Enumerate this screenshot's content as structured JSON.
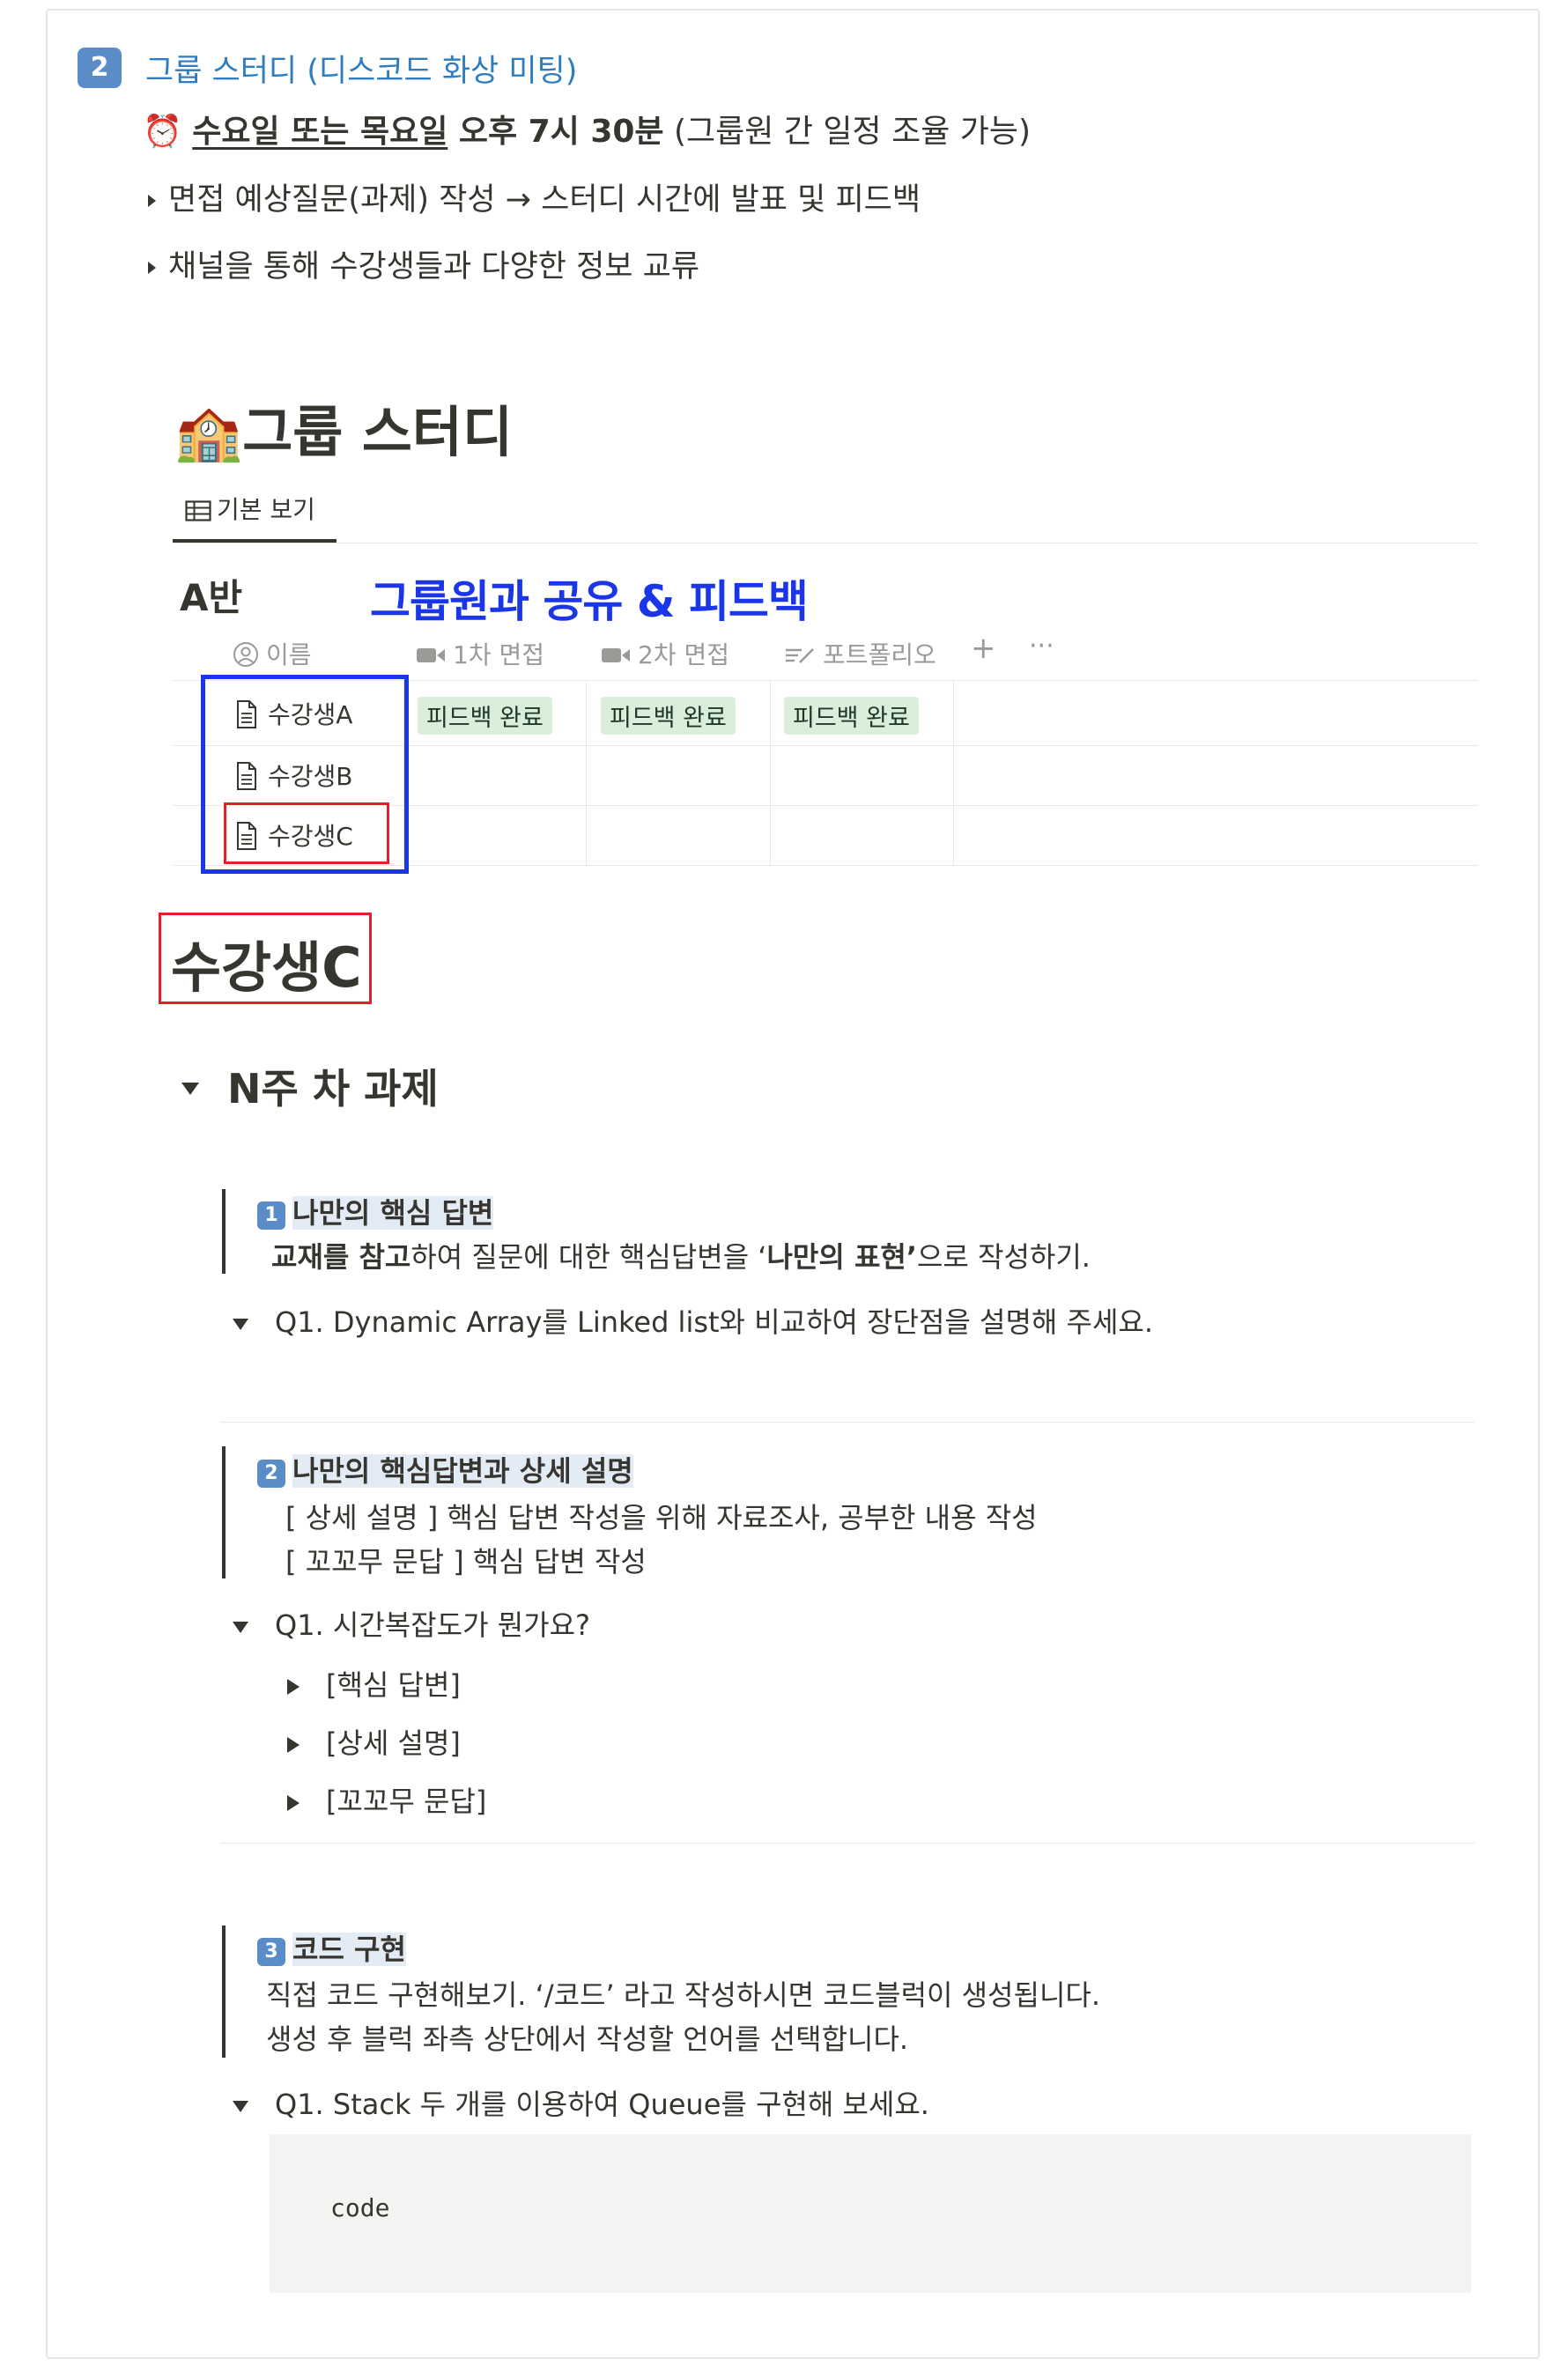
{
  "section": {
    "number": "2",
    "title": "그룹 스터디 (디스코드 화상 미팅)",
    "schedule_emoji": "⏰",
    "schedule_bold_underlined": "수요일 또는 목요일",
    "schedule_bold": " 오후 7시 30분",
    "schedule_rest": " (그룹원 간 일정 조율 가능)",
    "bullets": [
      "면접 예상질문(과제) 작성 → 스터디 시간에 발표 및 피드백",
      "채널을 통해 수강생들과 다양한 정보 교류"
    ]
  },
  "database": {
    "icon": "🏫",
    "title": "그룹 스터디",
    "view_tab": "기본 보기",
    "group_label": "A반",
    "annotation": "그룹원과 공유 & 피드백",
    "columns": [
      "이름",
      "1차 면접",
      "2차 면접",
      "포트폴리오"
    ],
    "add_symbol": "+",
    "more_symbol": "···",
    "rows": [
      {
        "name": "수강생A",
        "tags": [
          "피드백 완료",
          "피드백 완료",
          "피드백 완료"
        ]
      },
      {
        "name": "수강생B",
        "tags": []
      },
      {
        "name": "수강생C",
        "tags": []
      }
    ]
  },
  "page": {
    "title": "수강생C",
    "toggle_heading": "N주 차 과제"
  },
  "tasks": [
    {
      "number": "1",
      "heading": "나만의 핵심 답변",
      "desc_bold1": "교재를 참고",
      "desc_mid": "하여 질문에 대한 핵심답변을 ‘",
      "desc_bold2": "나만의 표현’",
      "desc_end": "으로 작성하기.",
      "question": "Q1. Dynamic Array를 Linked list와 비교하여 장단점을 설명해 주세요."
    },
    {
      "number": "2",
      "heading": "나만의 핵심답변과 상세 설명",
      "desc_lines": [
        "[ 상세 설명 ] 핵심 답변 작성을 위해 자료조사, 공부한 내용 작성",
        "[ 꼬꼬무 문답 ] 핵심 답변 작성"
      ],
      "question": "Q1. 시간복잡도가 뭔가요?",
      "sub_items": [
        "[핵심 답변]",
        "[상세 설명]",
        "[꼬꼬무 문답]"
      ]
    },
    {
      "number": "3",
      "heading": "코드 구현",
      "desc_lines": [
        "직접 코드 구현해보기. ‘/코드’ 라고 작성하시면 코드블럭이 생성됩니다.",
        "생성 후 블럭 좌측 상단에서 작성할 언어를 선택합니다."
      ],
      "question": "Q1. Stack 두 개를 이용하여 Queue를 구현해 보세요.",
      "code": "code"
    }
  ]
}
